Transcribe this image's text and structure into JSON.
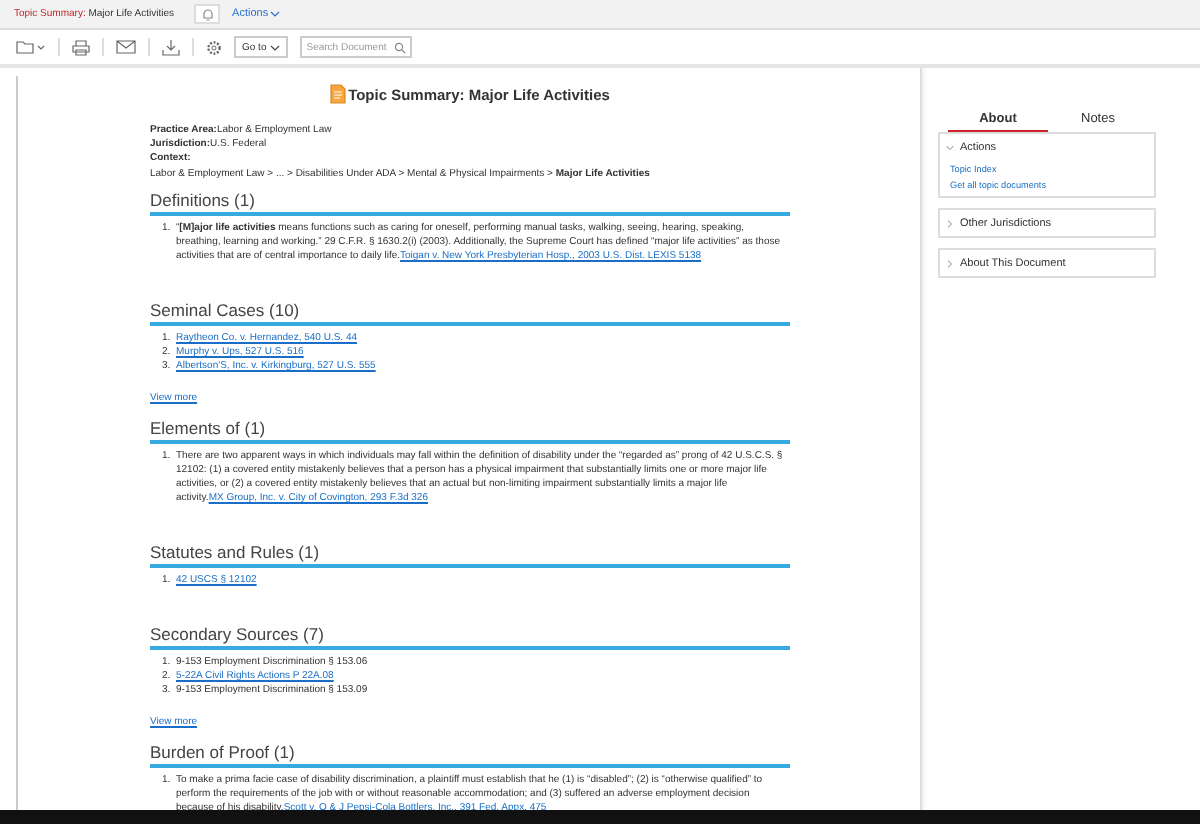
{
  "header": {
    "title_prefix": "Topic Summary:",
    "title": "Major Life Activities",
    "actions": "Actions"
  },
  "toolbar": {
    "goto": "Go to",
    "search": {
      "placeholder": "Search Document"
    }
  },
  "document": {
    "title": "Topic Summary: Major Life Activities",
    "meta": [
      {
        "label": "Practice Area:",
        "value": "Labor & Employment Law"
      },
      {
        "label": "Jurisdiction:",
        "value": "U.S. Federal"
      },
      {
        "label": "Context:"
      }
    ],
    "breadcrumb": "Labor & Employment Law > ... > Disabilities Under ADA > Mental & Physical Impairments > **Major Life Activities**",
    "sections": [
      {
        "heading": "Definitions (1)",
        "items": [
          {
            "number": "1.",
            "text": "“**[M]ajor life activities** means functions such as caring for oneself, performing manual tasks, walking, seeing, hearing, speaking, breathing, learning and working.” 29 C.F.R. § 1630.2(i) (2003). Additionally, the Supreme Court has defined “major life activities” as those activities that are of central importance to daily life.",
            "link": "Toigan v. New York Presbyterian Hosp., 2003 U.S. Dist. LEXIS 5138"
          }
        ]
      },
      {
        "heading": "Seminal Cases (10)",
        "items": [
          {
            "number": "1.",
            "link": "Raytheon Co. v. Hernandez, 540 U.S. 44"
          },
          {
            "number": "2.",
            "link": "Murphy v. Ups, 527 U.S. 516"
          },
          {
            "number": "3.",
            "link": "Albertson'S, Inc. v. Kirkingburg, 527 U.S. 555"
          }
        ],
        "view_more": "View more"
      },
      {
        "heading": "Elements of (1)",
        "items": [
          {
            "number": "1.",
            "text": "There are two apparent ways in which individuals may fall within the definition of disability under the “regarded as” prong of 42 U.S.C.S. § 12102: (1) a covered entity mistakenly believes that a person has a physical impairment that substantially limits one or more major life activities, or (2) a covered entity mistakenly believes that an actual but non-limiting impairment substantially limits a major life activity.",
            "link": "MX Group, Inc. v. City of Covington, 293 F.3d 326"
          }
        ]
      },
      {
        "heading": "Statutes and Rules (1)",
        "items": [
          {
            "number": "1.",
            "link": "42 USCS § 12102"
          }
        ]
      },
      {
        "heading": "Secondary Sources (7)",
        "items": [
          {
            "number": "1.",
            "text": "9-153 Employment Discrimination § 153.06"
          },
          {
            "number": "2.",
            "link": "5-22A Civil Rights Actions P 22A.08"
          },
          {
            "number": "3.",
            "text": "9-153 Employment Discrimination § 153.09"
          }
        ],
        "view_more": "View more"
      },
      {
        "heading": "Burden of Proof (1)",
        "items": [
          {
            "number": "1.",
            "text": "To make a prima facie case of disability discrimination, a plaintiff must establish that he (1) is “disabled”; (2) is “otherwise qualified” to perform the requirements of the job with or without reasonable accommodation; and (3) suffered an adverse employment decision because of his disability.",
            "link": "Scott v. O & J Pepsi-Cola Bottlers, Inc., 391 Fed. Appx. 475"
          }
        ]
      }
    ]
  },
  "sidebar": {
    "tabs": [
      {
        "label": "About",
        "selected": true
      },
      {
        "label": "Notes",
        "selected": false
      }
    ],
    "panels": [
      {
        "title": "Actions",
        "expanded": true,
        "links": [
          "Topic Index",
          "Get all topic documents"
        ]
      },
      {
        "title": "Other Jurisdictions",
        "expanded": false
      },
      {
        "title": "About This Document",
        "expanded": false
      }
    ]
  }
}
